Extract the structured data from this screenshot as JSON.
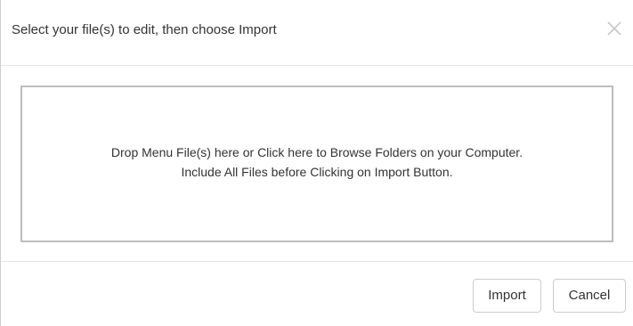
{
  "dialog": {
    "title": "Select your file(s) to edit, then choose Import",
    "close_icon": "close-icon"
  },
  "dropzone": {
    "line1": "Drop Menu File(s) here or Click here to Browse Folders on your Computer.",
    "line2": "Include All Files before Clicking on Import Button."
  },
  "footer": {
    "import_label": "Import",
    "cancel_label": "Cancel"
  },
  "colors": {
    "border": "#bdbdbd",
    "divider": "#e5e5e5",
    "text": "#333333",
    "close_icon": "#c8c8c8"
  }
}
